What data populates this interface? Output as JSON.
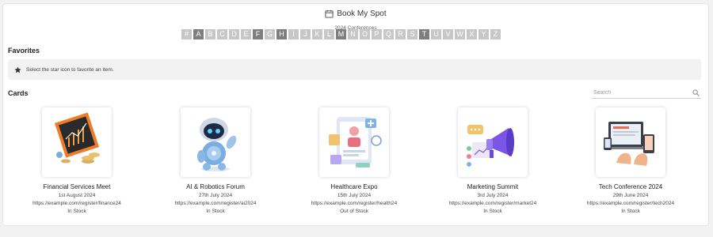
{
  "header": {
    "title": "Book My Spot",
    "subtitle": "2024 Conferences",
    "icon": "calendar-icon"
  },
  "alphabet": [
    {
      "letter": "#",
      "active": false
    },
    {
      "letter": "A",
      "active": true
    },
    {
      "letter": "B",
      "active": false
    },
    {
      "letter": "C",
      "active": false
    },
    {
      "letter": "D",
      "active": false
    },
    {
      "letter": "E",
      "active": false
    },
    {
      "letter": "F",
      "active": true
    },
    {
      "letter": "G",
      "active": false
    },
    {
      "letter": "H",
      "active": true
    },
    {
      "letter": "I",
      "active": false
    },
    {
      "letter": "J",
      "active": false
    },
    {
      "letter": "K",
      "active": false
    },
    {
      "letter": "L",
      "active": false
    },
    {
      "letter": "M",
      "active": true
    },
    {
      "letter": "N",
      "active": false
    },
    {
      "letter": "O",
      "active": false
    },
    {
      "letter": "P",
      "active": false
    },
    {
      "letter": "Q",
      "active": false
    },
    {
      "letter": "R",
      "active": false
    },
    {
      "letter": "S",
      "active": false
    },
    {
      "letter": "T",
      "active": true
    },
    {
      "letter": "U",
      "active": false
    },
    {
      "letter": "V",
      "active": false
    },
    {
      "letter": "W",
      "active": false
    },
    {
      "letter": "X",
      "active": false
    },
    {
      "letter": "Y",
      "active": false
    },
    {
      "letter": "Z",
      "active": false
    }
  ],
  "favorites": {
    "title": "Favorites",
    "message": "Select the star icon to favorite an item.",
    "icon": "star-icon"
  },
  "cards_section": {
    "title": "Cards",
    "search_placeholder": "Search",
    "search_icon": "search-icon"
  },
  "cards": [
    {
      "name": "Financial Services Meet",
      "date": "1st August 2024",
      "url": "https://example.com/register/finance24",
      "stock": "In Stock",
      "art": "finance"
    },
    {
      "name": "AI & Robotics Forum",
      "date": "27th July 2024",
      "url": "https://example.com/register/ai2024",
      "stock": "In Stock",
      "art": "robot"
    },
    {
      "name": "Healthcare Expo",
      "date": "15th July 2024",
      "url": "https://example.com/register/health24",
      "stock": "Out of Stock",
      "art": "health"
    },
    {
      "name": "Marketing Summit",
      "date": "3rd July 2024",
      "url": "https://example.com/register/market24",
      "stock": "In Stock",
      "art": "marketing"
    },
    {
      "name": "Tech Conference 2024",
      "date": "29th June 2024",
      "url": "https://example.com/register/tech2024",
      "stock": "In Stock",
      "art": "tech"
    }
  ],
  "colors": {
    "letter_inactive": "#c7c7c7",
    "letter_active": "#7e7e7e",
    "fav_bg": "#f2f2f2"
  }
}
